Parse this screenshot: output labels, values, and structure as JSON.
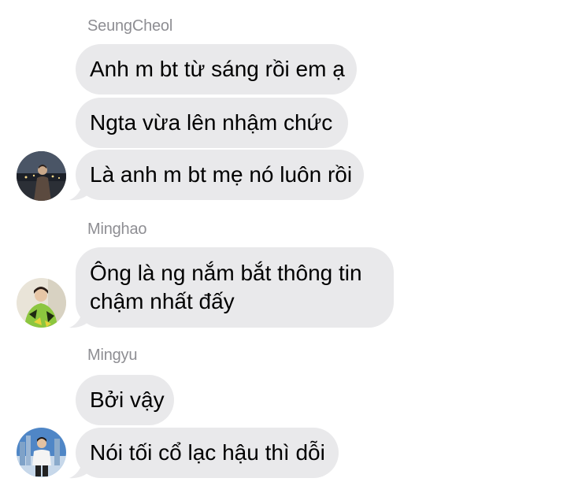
{
  "groups": [
    {
      "sender": "SeungCheol",
      "avatar_icon": "seungcheol-avatar-icon",
      "messages": [
        "Anh m bt từ sáng rồi em ạ",
        "Ngta vừa lên nhậm chức",
        "Là anh m bt mẹ nó luôn rồi"
      ]
    },
    {
      "sender": "Minghao",
      "avatar_icon": "minghao-avatar-icon",
      "messages": [
        "Ông là ng nắm bắt thông tin chậm nhất đấy"
      ]
    },
    {
      "sender": "Mingyu",
      "avatar_icon": "mingyu-avatar-icon",
      "messages": [
        "Bởi vậy",
        "Nói tối cổ lạc hậu thì dỗi"
      ]
    }
  ],
  "colors": {
    "bubble_bg": "#e9e9eb",
    "sender_text": "#8e8e93",
    "message_text": "#000000",
    "background": "#ffffff"
  }
}
